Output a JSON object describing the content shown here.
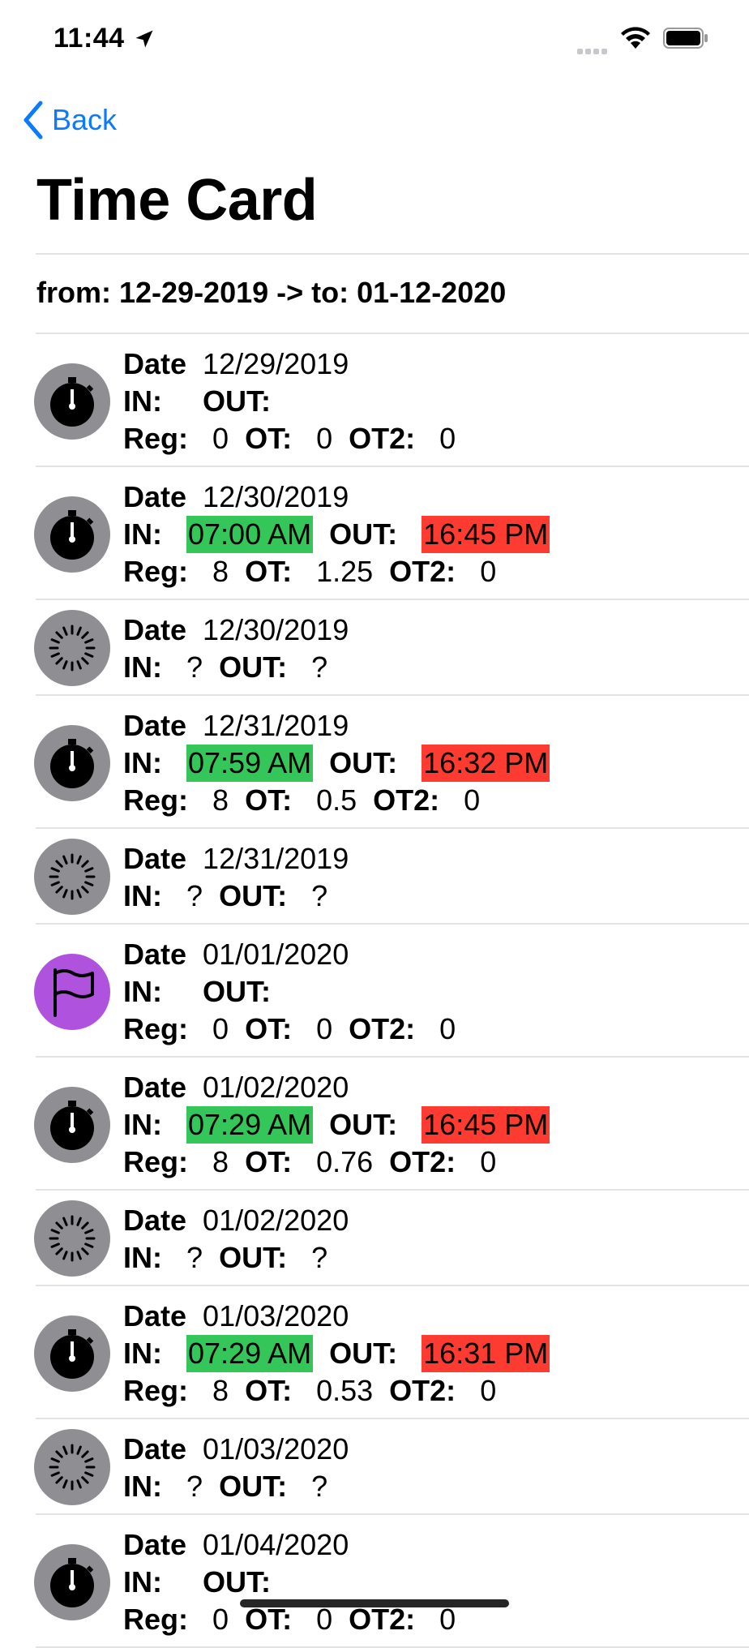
{
  "status_bar": {
    "time": "11:44"
  },
  "nav": {
    "back_label": "Back"
  },
  "page": {
    "title": "Time Card",
    "range": "from: 12-29-2019 -> to: 01-12-2020"
  },
  "labels": {
    "date": "Date",
    "in": "IN:",
    "out": "OUT:",
    "reg": "Reg:",
    "ot": "OT:",
    "ot2": "OT2:"
  },
  "colors": {
    "accent": "#0a7aff",
    "in_highlight": "#34c659",
    "out_highlight": "#fe3b30",
    "holiday": "#af52de",
    "icon_gray": "#8e8e93"
  },
  "entries": [
    {
      "icon": "stopwatch-icon",
      "date": "12/29/2019",
      "in": "",
      "out": "",
      "reg": "0",
      "ot": "0",
      "ot2": "0"
    },
    {
      "icon": "stopwatch-icon",
      "date": "12/30/2019",
      "in": "07:00 AM",
      "out": "16:45 PM",
      "reg": "8",
      "ot": "1.25",
      "ot2": "0"
    },
    {
      "icon": "pending-icon",
      "date": "12/30/2019",
      "in": "?",
      "out": "?"
    },
    {
      "icon": "stopwatch-icon",
      "date": "12/31/2019",
      "in": "07:59 AM",
      "out": "16:32 PM",
      "reg": "8",
      "ot": "0.5",
      "ot2": "0"
    },
    {
      "icon": "pending-icon",
      "date": "12/31/2019",
      "in": "?",
      "out": "?"
    },
    {
      "icon": "flag-icon",
      "date": "01/01/2020",
      "in": "",
      "out": "",
      "reg": "0",
      "ot": "0",
      "ot2": "0"
    },
    {
      "icon": "stopwatch-icon",
      "date": "01/02/2020",
      "in": "07:29 AM",
      "out": "16:45 PM",
      "reg": "8",
      "ot": "0.76",
      "ot2": "0"
    },
    {
      "icon": "pending-icon",
      "date": "01/02/2020",
      "in": "?",
      "out": "?"
    },
    {
      "icon": "stopwatch-icon",
      "date": "01/03/2020",
      "in": "07:29 AM",
      "out": "16:31 PM",
      "reg": "8",
      "ot": "0.53",
      "ot2": "0"
    },
    {
      "icon": "pending-icon",
      "date": "01/03/2020",
      "in": "?",
      "out": "?"
    },
    {
      "icon": "stopwatch-icon",
      "date": "01/04/2020",
      "in": "",
      "out": "",
      "reg": "0",
      "ot": "0",
      "ot2": "0"
    }
  ]
}
